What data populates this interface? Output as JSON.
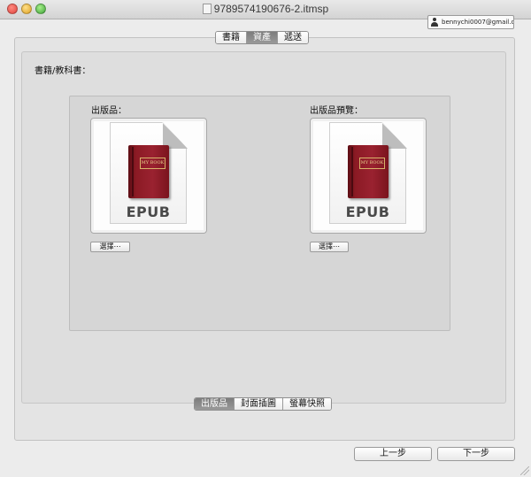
{
  "window": {
    "title": "9789574190676-2.itmsp"
  },
  "account": {
    "email": "bennychi0007@gmail.com"
  },
  "top_tabs": [
    {
      "label": "書籍",
      "active": false
    },
    {
      "label": "資產",
      "active": true
    },
    {
      "label": "遞送",
      "active": false
    }
  ],
  "section": {
    "label": "書籍/教科書："
  },
  "wells": [
    {
      "label": "出版品：",
      "plate": "MY BOOK",
      "format": "EPUB",
      "button": "選擇⋯"
    },
    {
      "label": "出版品預覽：",
      "plate": "MY BOOK",
      "format": "EPUB",
      "button": "選擇⋯"
    }
  ],
  "bottom_tabs": [
    {
      "label": "出版品",
      "active": true
    },
    {
      "label": "封面插圖",
      "active": false
    },
    {
      "label": "螢幕快照",
      "active": false
    }
  ],
  "navigation": {
    "back_label": "上一步",
    "next_label": "下一步"
  },
  "colors": {
    "window_bg": "#ececec",
    "active_segment": "#8a8a8a",
    "book_red": "#8b1a24"
  }
}
